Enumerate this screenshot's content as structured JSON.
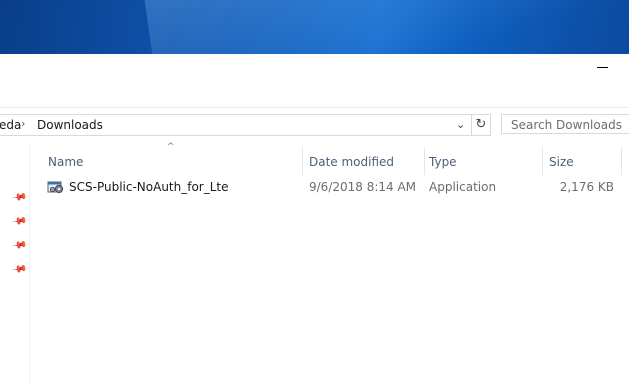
{
  "address_bar": {
    "prev_crumb": "eda",
    "separator": "›",
    "current": "Downloads",
    "dropdown_glyph": "⌄",
    "refresh_glyph": "↻"
  },
  "search": {
    "placeholder": "Search Downloads"
  },
  "columns": {
    "name": "Name",
    "date": "Date modified",
    "type": "Type",
    "size": "Size",
    "sort_indicator": "^"
  },
  "files": [
    {
      "name": "SCS-Public-NoAuth_for_Lte",
      "date": "9/6/2018 8:14 AM",
      "type": "Application",
      "size": "2,176 KB",
      "icon": "application-icon"
    }
  ],
  "nav_pins": [
    "pin-icon",
    "pin-icon",
    "pin-icon",
    "pin-icon"
  ],
  "colors": {
    "header_text": "#4c607a",
    "secondary_text": "#6d6d6d",
    "wallpaper": "#0f57b3"
  }
}
